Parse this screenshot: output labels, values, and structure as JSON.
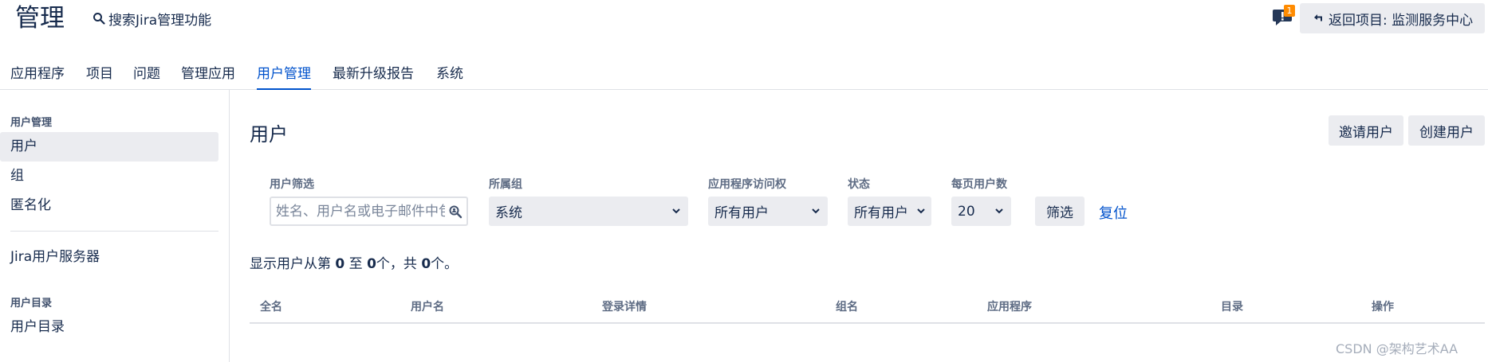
{
  "header": {
    "title": "管理",
    "search_label": "搜索Jira管理功能",
    "feedback_badge": "1",
    "return_label": "返回项目: 监测服务中心"
  },
  "topnav": {
    "items": [
      "应用程序",
      "项目",
      "问题",
      "管理应用",
      "用户管理",
      "最新升级报告",
      "系统"
    ],
    "active": "用户管理"
  },
  "sidebar": {
    "section1_heading": "用户管理",
    "items1": [
      "用户",
      "组",
      "匿名化"
    ],
    "selected": "用户",
    "jira_servers": "Jira用户服务器",
    "section2_heading": "用户目录",
    "items2": [
      "用户目录"
    ]
  },
  "main": {
    "title": "用户",
    "invite_button": "邀请用户",
    "create_button": "创建用户",
    "filters": {
      "user_filter_label": "用户筛选",
      "user_filter_placeholder": "姓名、用户名或电子邮件中包",
      "group_label": "所属组",
      "group_value": "系统",
      "app_access_label": "应用程序访问权",
      "app_access_value": "所有用户",
      "status_label": "状态",
      "status_value": "所有用户",
      "per_page_label": "每页用户数",
      "per_page_value": "20",
      "filter_button": "筛选",
      "reset_link": "复位"
    },
    "summary": {
      "prefix": "显示用户从第 ",
      "from": "0",
      "mid": " 至 ",
      "to": "0",
      "mid2": "个，共 ",
      "total": "0",
      "suffix": "个。"
    },
    "table_headers": [
      "全名",
      "用户名",
      "登录详情",
      "组名",
      "应用程序",
      "目录",
      "操作"
    ]
  },
  "watermark": "CSDN @架构艺术AA",
  "colors": {
    "accent": "#0052cc",
    "text": "#172b4d",
    "subtle_bg": "#ebecf0",
    "badge": "#ff8b00"
  }
}
